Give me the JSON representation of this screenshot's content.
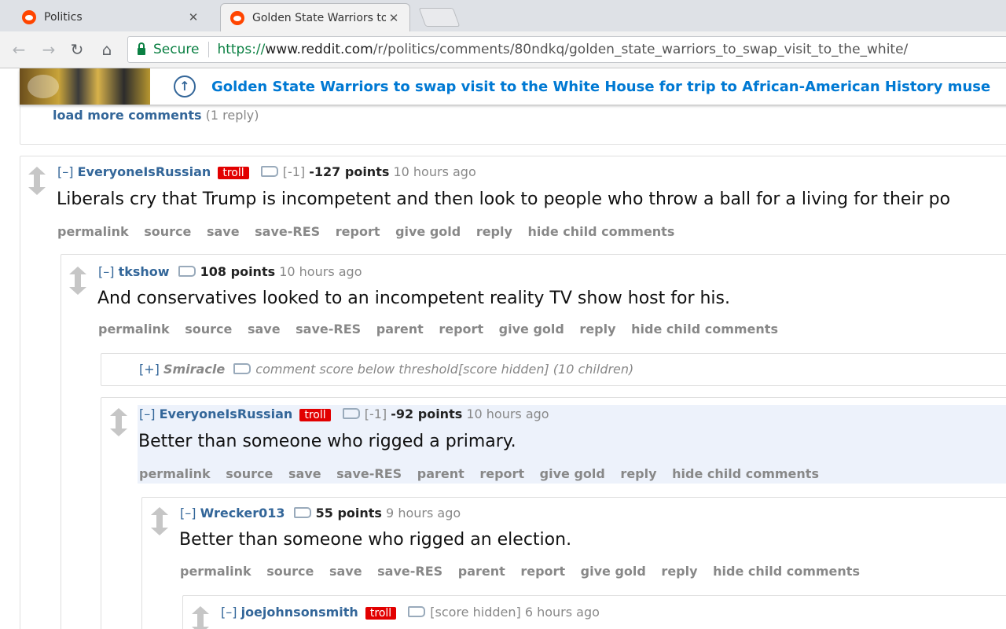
{
  "browser": {
    "tabs": [
      {
        "title": "Politics"
      },
      {
        "title": "Golden State Warriors to"
      }
    ],
    "close_glyph": "✕",
    "security_label": "Secure",
    "url": {
      "proto": "https://",
      "host": "www.reddit.com",
      "path": "/r/politics/comments/80ndkq/golden_state_warriors_to_swap_visit_to_the_white/"
    }
  },
  "header": {
    "title": "Golden State Warriors to swap visit to the White House for trip to African-American History muse"
  },
  "load_more": {
    "label": "load more comments",
    "count": "(1 reply)"
  },
  "comments": [
    {
      "expand": "[–]",
      "author": "EveryoneIsRussian",
      "flair": "troll",
      "controversy": "[-1]",
      "score": "-127 points",
      "time": "10 hours ago",
      "body": "Liberals cry that Trump is incompetent and then look to people who throw a ball for a living for their po",
      "buttons": [
        "permalink",
        "source",
        "save",
        "save-RES",
        "report",
        "give gold",
        "reply",
        "hide child comments"
      ]
    },
    {
      "expand": "[–]",
      "author": "tkshow",
      "score": "108 points",
      "time": "10 hours ago",
      "body": "And conservatives looked to an incompetent reality TV show host for his.",
      "buttons": [
        "permalink",
        "source",
        "save",
        "save-RES",
        "parent",
        "report",
        "give gold",
        "reply",
        "hide child comments"
      ]
    },
    {
      "expand": "[+]",
      "author": "Smiracle",
      "note": "comment score below threshold[score hidden]",
      "children": "(10 children)"
    },
    {
      "expand": "[–]",
      "author": "EveryoneIsRussian",
      "flair": "troll",
      "controversy": "[-1]",
      "score": "-92 points",
      "time": "10 hours ago",
      "body": "Better than someone who rigged a primary.",
      "buttons": [
        "permalink",
        "source",
        "save",
        "save-RES",
        "parent",
        "report",
        "give gold",
        "reply",
        "hide child comments"
      ]
    },
    {
      "expand": "[–]",
      "author": "Wrecker013",
      "score": "55 points",
      "time": "9 hours ago",
      "body": "Better than someone who rigged an election.",
      "buttons": [
        "permalink",
        "source",
        "save",
        "save-RES",
        "parent",
        "report",
        "give gold",
        "reply",
        "hide child comments"
      ]
    },
    {
      "expand": "[–]",
      "author": "joejohnsonsmith",
      "flair": "troll",
      "score_hidden": "[score hidden]",
      "time": "6 hours ago"
    }
  ],
  "colors": {
    "link": "#336699",
    "flair": "#e20000",
    "secure": "#0b8043",
    "highlight": "#edf2fb"
  }
}
